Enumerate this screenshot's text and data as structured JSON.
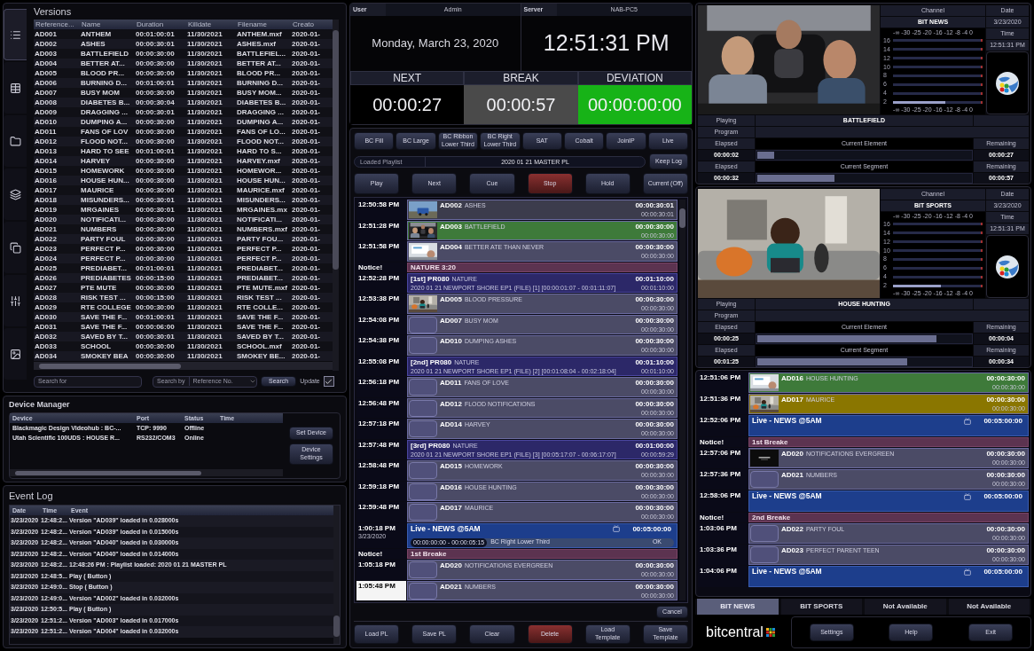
{
  "versions": {
    "title": "Versions",
    "side_tabs": [
      {
        "selected": true
      },
      {
        "selected": false
      },
      {
        "selected": false
      },
      {
        "selected": false
      },
      {
        "selected": false
      },
      {
        "selected": false
      },
      {
        "selected": false
      }
    ],
    "columns": [
      "Reference...",
      "Name",
      "Duration",
      "Killdate",
      "Filename",
      "Creato"
    ],
    "rows": [
      [
        "AD001",
        "ANTHEM",
        "00:01:00:01",
        "11/30/2021",
        "ANTHEM.mxf",
        "2020-01-"
      ],
      [
        "AD002",
        "ASHES",
        "00:00:30:01",
        "11/30/2021",
        "ASHES.mxf",
        "2020-01-"
      ],
      [
        "AD003",
        "BATTLEFIELD",
        "00:00:30:00",
        "11/30/2021",
        "BATTLEFIEL...",
        "2020-01-"
      ],
      [
        "AD004",
        "BETTER AT...",
        "00:00:30:00",
        "11/30/2021",
        "BETTER AT...",
        "2020-01-"
      ],
      [
        "AD005",
        "BLOOD PR...",
        "00:00:30:00",
        "11/30/2021",
        "BLOOD PR...",
        "2020-01-"
      ],
      [
        "AD006",
        "BURNING D...",
        "00:01:00:01",
        "11/30/2021",
        "BURNING D...",
        "2020-01-"
      ],
      [
        "AD007",
        "BUSY MOM",
        "00:00:30:00",
        "11/30/2021",
        "BUSY MOM...",
        "2020-01-"
      ],
      [
        "AD008",
        "DIABETES B...",
        "00:00:30:04",
        "11/30/2021",
        "DIABETES B...",
        "2020-01-"
      ],
      [
        "AD009",
        "DRAGGING ...",
        "00:00:30:01",
        "11/30/2021",
        "DRAGGING ...",
        "2020-01-"
      ],
      [
        "AD010",
        "DUMPING A...",
        "00:00:30:00",
        "11/30/2021",
        "DUMPING A...",
        "2020-01-"
      ],
      [
        "AD011",
        "FANS OF LOV",
        "00:00:30:00",
        "11/30/2021",
        "FANS OF LO...",
        "2020-01-"
      ],
      [
        "AD012",
        "FLOOD NOT...",
        "00:00:30:00",
        "11/30/2021",
        "FLOOD NOT...",
        "2020-01-"
      ],
      [
        "AD013",
        "HARD TO SEE",
        "00:01:00:01",
        "11/30/2021",
        "HARD TO S...",
        "2020-01-"
      ],
      [
        "AD014",
        "HARVEY",
        "00:00:30:00",
        "11/30/2021",
        "HARVEY.mxf",
        "2020-01-"
      ],
      [
        "AD015",
        "HOMEWORK",
        "00:00:30:00",
        "11/30/2021",
        "HOMEWOR...",
        "2020-01-"
      ],
      [
        "AD016",
        "HOUSE HUN...",
        "00:00:30:00",
        "11/30/2021",
        "HOUSE HUN...",
        "2020-01-"
      ],
      [
        "AD017",
        "MAURICE",
        "00:00:30:00",
        "11/30/2021",
        "MAURICE.mxf",
        "2020-01-"
      ],
      [
        "AD018",
        "MISUNDERS...",
        "00:00:30:01",
        "11/30/2021",
        "MISUNDERS...",
        "2020-01-"
      ],
      [
        "AD019",
        "MRGAINES",
        "00:00:30:01",
        "11/30/2021",
        "MRGAINES.mx",
        "2020-01-"
      ],
      [
        "AD020",
        "NOTIFICATI...",
        "00:00:30:00",
        "11/30/2021",
        "NOTIFICATI...",
        "2020-01-"
      ],
      [
        "AD021",
        "NUMBERS",
        "00:00:30:00",
        "11/30/2021",
        "NUMBERS.mxf",
        "2020-01-"
      ],
      [
        "AD022",
        "PARTY FOUL",
        "00:00:30:00",
        "11/30/2021",
        "PARTY FOU...",
        "2020-01-"
      ],
      [
        "AD023",
        "PERFECT P...",
        "00:00:30:00",
        "11/30/2021",
        "PERFECT P...",
        "2020-01-"
      ],
      [
        "AD024",
        "PERFECT P...",
        "00:00:30:00",
        "11/30/2021",
        "PERFECT P...",
        "2020-01-"
      ],
      [
        "AD025",
        "PREDIABET...",
        "00:01:00:01",
        "11/30/2021",
        "PREDIABET...",
        "2020-01-"
      ],
      [
        "AD026",
        "PREDIABETES",
        "00:00:15:00",
        "11/30/2021",
        "PREDIABET...",
        "2020-01-"
      ],
      [
        "AD027",
        "PTE MUTE",
        "00:00:30:00",
        "11/30/2021",
        "PTE MUTE.mxf",
        "2020-01-"
      ],
      [
        "AD028",
        "RISK TEST ...",
        "00:00:15:00",
        "11/30/2021",
        "RISK TEST ...",
        "2020-01-"
      ],
      [
        "AD029",
        "RTE COLLEGE",
        "00:00:30:00",
        "11/30/2021",
        "RTE COLLE...",
        "2020-01-"
      ],
      [
        "AD030",
        "SAVE THE F...",
        "00:01:00:01",
        "11/30/2021",
        "SAVE THE F...",
        "2020-01-"
      ],
      [
        "AD031",
        "SAVE THE F...",
        "00:00:06:00",
        "11/30/2021",
        "SAVE THE F...",
        "2020-01-"
      ],
      [
        "AD032",
        "SAVED BY T...",
        "00:00:30:01",
        "11/30/2021",
        "SAVED BY T...",
        "2020-01-"
      ],
      [
        "AD033",
        "SCHOOL",
        "00:00:30:00",
        "11/30/2021",
        "SCHOOL.mxf",
        "2020-01-"
      ],
      [
        "AD034",
        "SMOKEY BEA",
        "00:00:30:00",
        "11/30/2021",
        "SMOKEY BE...",
        "2020-01-"
      ]
    ],
    "search": {
      "label": "Search for",
      "by_label": "Search by",
      "by_value": "Reference No.",
      "button": "Search",
      "update_label": "Update",
      "update_checked": true
    }
  },
  "device_manager": {
    "title": "Device Manager",
    "columns": [
      "Device",
      "Port",
      "Status",
      "Time"
    ],
    "rows": [
      [
        "Blackmagic Design Videohub : BC-...",
        "TCP: 9990",
        "Offline"
      ],
      [
        "Utah Scientific 100UDS : HOUSE R...",
        "RS232/COM3",
        "Online"
      ]
    ],
    "buttons": [
      "Set Device",
      "Device Settings"
    ]
  },
  "event_log": {
    "title": "Event Log",
    "columns": [
      "Date",
      "Time",
      "Event"
    ],
    "rows": [
      [
        "3/23/2020",
        "12:48:2...",
        "Version \"AD039\" loaded in 0.028000s"
      ],
      [
        "3/23/2020",
        "12:48:2...",
        "Version \"AD039\" loaded in 0.015000s"
      ],
      [
        "3/23/2020",
        "12:48:2...",
        "Version \"AD040\" loaded in 0.030000s"
      ],
      [
        "3/23/2020",
        "12:48:2...",
        "Version \"AD040\" loaded in 0.014000s"
      ],
      [
        "3/23/2020",
        "12:48:2...",
        "12:48:26 PM : Playlist loaded: 2020 01 21 MASTER PL"
      ],
      [
        "3/23/2020",
        "12:48:5...",
        "Play ( Button )"
      ],
      [
        "3/23/2020",
        "12:49:0...",
        "Stop ( Button )"
      ],
      [
        "3/23/2020",
        "12:49:0...",
        "Version \"AD002\" loaded in 0.032000s"
      ],
      [
        "3/23/2020",
        "12:50:5...",
        "Play ( Button )"
      ],
      [
        "3/23/2020",
        "12:51:2...",
        "Version \"AD003\" loaded in 0.017000s"
      ],
      [
        "3/23/2020",
        "12:51:2...",
        "Version \"AD004\" loaded in 0.032000s"
      ]
    ]
  },
  "status": {
    "user_label": "User",
    "user": "Admin",
    "server_label": "Server",
    "server": "NAB-PC5",
    "date": "Monday, March 23, 2020",
    "time": "12:51:31 PM"
  },
  "counters": [
    {
      "label": "NEXT",
      "value": "00:00:27",
      "color": "#000000"
    },
    {
      "label": "BREAK",
      "value": "00:00:57",
      "color": "#4a4a4a"
    },
    {
      "label": "DEVIATION",
      "value": "00:00:00:00",
      "color": "#17b317"
    }
  ],
  "graphics_buttons": [
    "BC Fill",
    "BC Large",
    "BC Ribbon Lower Third",
    "BC Right Lower Third",
    "SAT",
    "Cobalt",
    "JoinIP",
    "Live"
  ],
  "loaded_playlist": {
    "label": "Loaded Playlist",
    "value": "2020 01 21 MASTER PL",
    "button": "Keep Log"
  },
  "transport": [
    {
      "label": "Play",
      "kind": "normal"
    },
    {
      "label": "Next",
      "kind": "normal"
    },
    {
      "label": "Cue",
      "kind": "normal"
    },
    {
      "label": "Stop",
      "kind": "danger"
    },
    {
      "label": "Hold",
      "kind": "normal"
    },
    {
      "label": "Current (Off)",
      "kind": "normal"
    }
  ],
  "playlist": [
    {
      "kind": "ad",
      "time": "12:50:58 PM",
      "code": "AD002",
      "title": "ASHES",
      "duration": "00:00:30:01",
      "planned": "00:00:30:01",
      "thumbnail_image": true,
      "color": "#3c3c4c",
      "selected": false
    },
    {
      "kind": "ad",
      "time": "12:51:28 PM",
      "code": "AD003",
      "title": "BATTLEFIELD",
      "duration": "00:00:30:00",
      "planned": "00:00:30:00",
      "thumbnail_image": true,
      "color": "#3e7a3a",
      "selected": false
    },
    {
      "kind": "ad",
      "time": "12:51:58 PM",
      "code": "AD004",
      "title": "BETTER ATE THAN NEVER",
      "duration": "00:00:30:00",
      "planned": "00:00:30:00",
      "thumbnail_image": true,
      "color": "#4b4b66",
      "selected": false
    },
    {
      "kind": "notice",
      "time": "Notice!",
      "title": "NATURE 3:20",
      "selected": false
    },
    {
      "kind": "program",
      "time": "12:52:28 PM",
      "code": "[1st] PR080",
      "title": "NATURE",
      "detail": "2020 01 21 NEWPORT SHORE EP1 (FILE) [1] [00:00:01:07 - 00:01:11:07]",
      "duration": "00:01:10:00",
      "planned": "00:01:10:00",
      "selected": false
    },
    {
      "kind": "ad",
      "time": "12:53:38 PM",
      "code": "AD005",
      "title": "BLOOD PRESSURE",
      "duration": "00:00:30:00",
      "planned": "00:00:30:00",
      "thumbnail_image": true,
      "color": "#4b4b66",
      "selected": false
    },
    {
      "kind": "ad",
      "time": "12:54:08 PM",
      "code": "AD007",
      "title": "BUSY MOM",
      "duration": "00:00:30:00",
      "planned": "00:00:30:00",
      "thumbnail_image": false,
      "color": "#4b4b66",
      "selected": false
    },
    {
      "kind": "ad",
      "time": "12:54:38 PM",
      "code": "AD010",
      "title": "DUMPING ASHES",
      "duration": "00:00:30:00",
      "planned": "00:00:30:00",
      "thumbnail_image": false,
      "color": "#4b4b66",
      "selected": false
    },
    {
      "kind": "program",
      "time": "12:55:08 PM",
      "code": "[2nd] PR080",
      "title": "NATURE",
      "detail": "2020 01 21 NEWPORT SHORE EP1 (FILE) [2] [00:01:08:04 - 00:02:18:04]",
      "duration": "00:01:10:00",
      "planned": "00:01:10:00",
      "selected": false
    },
    {
      "kind": "ad",
      "time": "12:56:18 PM",
      "code": "AD011",
      "title": "FANS OF LOVE",
      "duration": "00:00:30:00",
      "planned": "00:00:30:00",
      "thumbnail_image": false,
      "color": "#4b4b66",
      "selected": false
    },
    {
      "kind": "ad",
      "time": "12:56:48 PM",
      "code": "AD012",
      "title": "FLOOD NOTIFICATIONS",
      "duration": "00:00:30:00",
      "planned": "00:00:30:00",
      "thumbnail_image": false,
      "color": "#4b4b66",
      "selected": false
    },
    {
      "kind": "ad",
      "time": "12:57:18 PM",
      "code": "AD014",
      "title": "HARVEY",
      "duration": "00:00:30:00",
      "planned": "00:00:30:00",
      "thumbnail_image": false,
      "color": "#4b4b66",
      "selected": false
    },
    {
      "kind": "program",
      "time": "12:57:48 PM",
      "code": "[3rd] PR080",
      "title": "NATURE",
      "detail": "2020 01 21 NEWPORT SHORE EP1 (FILE) [3] [00:05:17:07 - 00:06:17:07]",
      "duration": "00:01:00:00",
      "planned": "00:00:59:29",
      "selected": false
    },
    {
      "kind": "ad",
      "time": "12:58:48 PM",
      "code": "AD015",
      "title": "HOMEWORK",
      "duration": "00:00:30:00",
      "planned": "00:00:30:00",
      "thumbnail_image": false,
      "color": "#4b4b66",
      "selected": false
    },
    {
      "kind": "ad",
      "time": "12:59:18 PM",
      "code": "AD016",
      "title": "HOUSE HUNTING",
      "duration": "00:00:30:00",
      "planned": "00:00:30:00",
      "thumbnail_image": false,
      "color": "#4b4b66",
      "selected": false
    },
    {
      "kind": "ad",
      "time": "12:59:48 PM",
      "code": "AD017",
      "title": "MAURICE",
      "duration": "00:00:30:00",
      "planned": "00:00:30:00",
      "thumbnail_image": false,
      "color": "#4b4b66",
      "selected": false
    },
    {
      "kind": "live",
      "time": "1:00:18 PM",
      "date": "3/23/2020",
      "title": "Live - NEWS @5AM",
      "duration": "00:05:00:00",
      "event": {
        "range": "00:00:00:00 - 00:00:05:15",
        "name": "BC Right Lower Third",
        "status": "OK"
      },
      "selected": false
    },
    {
      "kind": "notice",
      "time": "Notice!",
      "title": "1st Breake",
      "selected": false
    },
    {
      "kind": "ad",
      "time": "1:05:18 PM",
      "code": "AD020",
      "title": "NOTIFICATIONS EVERGREEN",
      "duration": "00:00:30:00",
      "planned": "00:00:30:00",
      "thumbnail_image": false,
      "color": "#4b4b66",
      "selected": false
    },
    {
      "kind": "ad",
      "time": "1:05:48 PM",
      "code": "AD021",
      "title": "NUMBERS",
      "duration": "00:00:30:00",
      "planned": "00:00:30:00",
      "thumbnail_image": false,
      "color": "#4b4b66",
      "selected": true
    }
  ],
  "cancel": "Cancel",
  "bottom_buttons": [
    {
      "label": "Load PL",
      "kind": "normal"
    },
    {
      "label": "Save PL",
      "kind": "normal"
    },
    {
      "label": "Clear",
      "kind": "normal"
    },
    {
      "label": "Delete",
      "kind": "danger"
    },
    {
      "label": "Load Template",
      "kind": "normal"
    },
    {
      "label": "Save Template",
      "kind": "normal"
    }
  ],
  "monitors": [
    {
      "channel_label": "Channel",
      "channel": "BIT NEWS",
      "date_label": "Date",
      "date": "3/23/2020",
      "time_label": "Time",
      "time": "12:51:31 PM",
      "meter": {
        "scale_top": "-∞ -30 -25 -20 -16 -12 -8 -4 0",
        "scale_bottom": "-∞ -30 -25 -20 -16 -12 -8 -4 0",
        "bars": [
          {
            "label": "16"
          },
          {
            "label": "14"
          },
          {
            "label": "12"
          },
          {
            "label": "10"
          },
          {
            "label": "8"
          },
          {
            "label": "6"
          },
          {
            "label": "4"
          },
          {
            "label": "2",
            "level": 0.6
          }
        ]
      },
      "playing_label": "Playing",
      "playing": "BATTLEFIELD",
      "program_label": "Program",
      "progress": [
        {
          "elapsed_label": "Elapsed",
          "title": "Current Element",
          "remaining_label": "Remaining",
          "elapsed": "00:00:02",
          "remaining": "00:00:27",
          "level": 0.08
        },
        {
          "elapsed_label": "Elapsed",
          "title": "Current Segment",
          "remaining_label": "Remaining",
          "elapsed": "00:00:32",
          "remaining": "00:00:57",
          "level": 0.36
        }
      ]
    },
    {
      "channel_label": "Channel",
      "channel": "BIT SPORTS",
      "date_label": "Date",
      "date": "3/23/2020",
      "time_label": "Time",
      "time": "12:51:31 PM",
      "meter": {
        "scale_top": "-∞ -30 -25 -20 -16 -12 -8 -4 0",
        "scale_bottom": "-∞ -30 -25 -20 -16 -12 -8 -4 0",
        "bars": [
          {
            "label": "16"
          },
          {
            "label": "14"
          },
          {
            "label": "12"
          },
          {
            "label": "10"
          },
          {
            "label": "8"
          },
          {
            "label": "6"
          },
          {
            "label": "4"
          },
          {
            "label": "2",
            "level": 0.55
          }
        ]
      },
      "playing_label": "Playing",
      "playing": "HOUSE HUNTING",
      "program_label": "Program",
      "progress": [
        {
          "elapsed_label": "Elapsed",
          "title": "Current Element",
          "remaining_label": "Remaining",
          "elapsed": "00:00:25",
          "remaining": "00:00:04",
          "level": 0.84
        },
        {
          "elapsed_label": "Elapsed",
          "title": "Current Segment",
          "remaining_label": "Remaining",
          "elapsed": "00:01:25",
          "remaining": "00:00:34",
          "level": 0.7
        }
      ]
    }
  ],
  "air_playlist": [
    {
      "kind": "ad",
      "time": "12:51:06 PM",
      "code": "AD016",
      "title": "HOUSE HUNTING",
      "duration": "00:00:30:00",
      "planned": "00:00:30:00",
      "thumbnail_image": true,
      "color": "#3e7a3a",
      "selected": false
    },
    {
      "kind": "ad",
      "time": "12:51:36 PM",
      "code": "AD017",
      "title": "MAURICE",
      "duration": "00:00:30:00",
      "planned": "00:00:30:00",
      "thumbnail_image": true,
      "color": "#8a7600",
      "selected": false
    },
    {
      "kind": "live",
      "time": "12:52:06 PM",
      "title": "Live - NEWS @5AM",
      "duration": "00:05:00:00",
      "selected": false
    },
    {
      "kind": "notice",
      "time": "Notice!",
      "title": "1st Breake",
      "selected": false
    },
    {
      "kind": "ad",
      "time": "12:57:06 PM",
      "code": "AD020",
      "title": "NOTIFICATIONS EVERGREEN",
      "duration": "00:00:30:00",
      "planned": "00:00:30:00",
      "thumbnail_image": true,
      "color": "#4b4b66",
      "selected": false
    },
    {
      "kind": "ad",
      "time": "12:57:36 PM",
      "code": "AD021",
      "title": "NUMBERS",
      "duration": "00:00:30:00",
      "planned": "00:00:30:00",
      "thumbnail_image": false,
      "color": "#4b4b66",
      "selected": false
    },
    {
      "kind": "live",
      "time": "12:58:06 PM",
      "title": "Live - NEWS @5AM",
      "duration": "00:05:00:00",
      "selected": false
    },
    {
      "kind": "notice",
      "time": "Notice!",
      "title": "2nd Breake",
      "selected": false
    },
    {
      "kind": "ad",
      "time": "1:03:06 PM",
      "code": "AD022",
      "title": "PARTY FOUL",
      "duration": "00:00:30:00",
      "planned": "00:00:30:00",
      "thumbnail_image": false,
      "color": "#4b4b66",
      "selected": false
    },
    {
      "kind": "ad",
      "time": "1:03:36 PM",
      "code": "AD023",
      "title": "PERFECT PARENT TEEN",
      "duration": "00:00:30:00",
      "planned": "00:00:30:00",
      "thumbnail_image": false,
      "color": "#4b4b66",
      "selected": false
    },
    {
      "kind": "live",
      "time": "1:04:06 PM",
      "title": "Live - NEWS @5AM",
      "duration": "00:05:00:00",
      "selected": false
    }
  ],
  "channel_tabs": [
    {
      "label": "BIT NEWS",
      "selected": true
    },
    {
      "label": "BIT SPORTS",
      "selected": false
    },
    {
      "label": "Not Available",
      "selected": false
    },
    {
      "label": "Not Available",
      "selected": false
    }
  ],
  "brand": "bitcentral",
  "footer_buttons": [
    "Settings",
    "Help",
    "Exit"
  ]
}
